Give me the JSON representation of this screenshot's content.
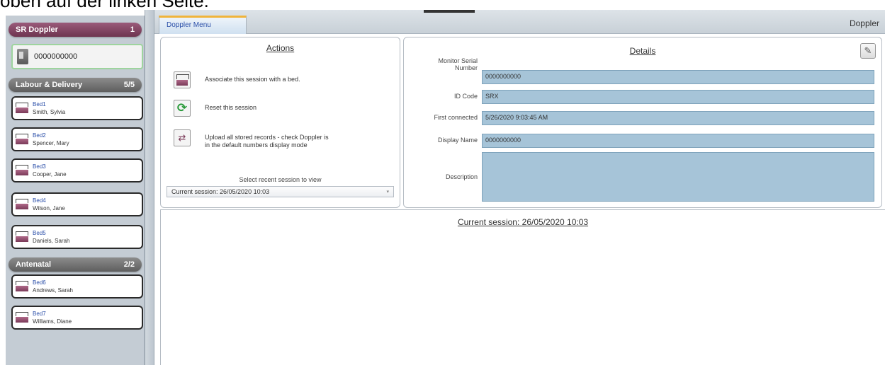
{
  "top_caption": "oben auf der linken Seite.",
  "sidebar": {
    "doppler_group": {
      "title": "SR Doppler",
      "count": "1"
    },
    "device": {
      "label": "0000000000"
    },
    "labour_group": {
      "title": "Labour & Delivery",
      "count": "5/5"
    },
    "labour_beds": [
      {
        "bed": "Bed1",
        "patient": "Smith, Sylvia"
      },
      {
        "bed": "Bed2",
        "patient": "Spencer, Mary"
      },
      {
        "bed": "Bed3",
        "patient": "Cooper, Jane"
      },
      {
        "bed": "Bed4",
        "patient": "Wilson, Jane"
      },
      {
        "bed": "Bed5",
        "patient": "Daniels, Sarah"
      }
    ],
    "antenatal_group": {
      "title": "Antenatal",
      "count": "2/2"
    },
    "antenatal_beds": [
      {
        "bed": "Bed6",
        "patient": "Andrews, Sarah"
      },
      {
        "bed": "Bed7",
        "patient": "Williams, Diane"
      }
    ]
  },
  "header": {
    "tab": "Doppler Menu",
    "title": "Doppler"
  },
  "actions": {
    "heading": "Actions",
    "items": [
      {
        "label": "Associate this session with  a bed.",
        "icon": "bed-icon"
      },
      {
        "label": "Reset this session",
        "icon": "refresh-icon"
      },
      {
        "label": "Upload all stored records - check Doppler is in the default numbers display mode",
        "icon": "upload-icon"
      }
    ],
    "select_caption": "Select recent session to view",
    "session_value": "Current session: 26/05/2020 10:03"
  },
  "details": {
    "heading": "Details",
    "fields": [
      {
        "label": "Monitor Serial Number",
        "value": "0000000000"
      },
      {
        "label": "ID Code",
        "value": "SRX"
      },
      {
        "label": "First connected",
        "value": "5/26/2020 9:03:45 AM"
      },
      {
        "label": "Display Name",
        "value": "0000000000"
      },
      {
        "label": "Description",
        "value": ""
      }
    ]
  },
  "session_panel": {
    "title": "Current session: 26/05/2020 10:03"
  },
  "colors": {
    "doppler_header": "#7e4462",
    "group_header": "#707070",
    "field_fill": "#a6c4d8",
    "active_card_border": "#9ed49e",
    "tab_accent": "#f0b43a"
  }
}
